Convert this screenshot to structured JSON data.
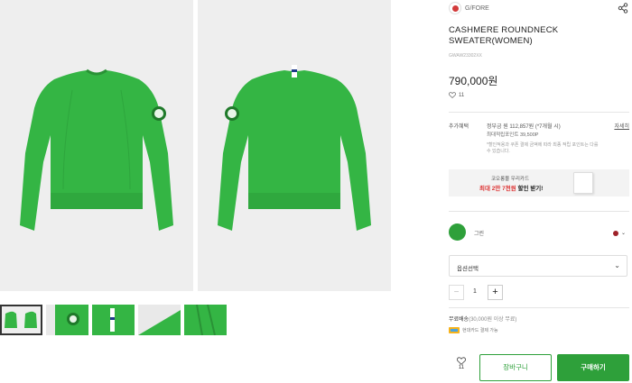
{
  "brand": {
    "name": "G/FORE",
    "logo_icon": "gfore-logo-icon"
  },
  "product": {
    "title": "CASHMERE ROUNDNECK SWEATER(WOMEN)",
    "code": "GWAW23302XX",
    "price": "790,000원",
    "likes": "11"
  },
  "benefits": {
    "label": "추가혜택",
    "main": "정부금 원 112,857원 (*7개월 시)",
    "detail_link": "자세히",
    "points": "최대적립포인트 39,500P",
    "note": "*할인적용과 쿠폰 결제 금액에 따라 최종 적립 포인트는 다를 수 있습니다."
  },
  "card_banner": {
    "line1": "코오롱몰 우리카드",
    "line2_prefix": "최대 2만 7천원",
    "line2_suffix": " 할인 받기!"
  },
  "color": {
    "swatch_hex": "#2ea03a",
    "label": "그린",
    "alt_hex": "#9e2229"
  },
  "option": {
    "placeholder": "옵션선택"
  },
  "quantity": {
    "value": "1",
    "minus": "−",
    "plus": "+"
  },
  "shipping": {
    "text": "무료배송",
    "condition": "(30,000원 이상 무료)",
    "pay_text": "현대카드 결제 가능"
  },
  "actions": {
    "wish_count": "11",
    "cart": "장바구니",
    "buy": "구매하기"
  },
  "colors": {
    "accent": "#2ea03a",
    "sale": "#d33333"
  }
}
